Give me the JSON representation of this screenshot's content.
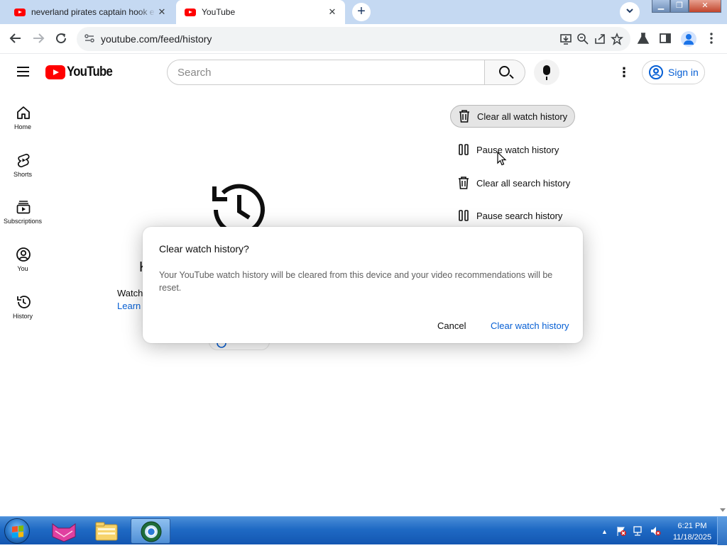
{
  "browser": {
    "tabs": [
      {
        "title": "neverland pirates captain hook e",
        "close": "✕"
      },
      {
        "title": "YouTube",
        "close": "✕"
      }
    ],
    "new_tab": "+",
    "url": "youtube.com/feed/history"
  },
  "masthead": {
    "logo_text": "YouTube",
    "search_placeholder": "Search",
    "kebab": "⋮",
    "sign_in_label": "Sign in"
  },
  "guide": {
    "items": [
      {
        "label": "Home",
        "icon": "home-icon"
      },
      {
        "label": "Shorts",
        "icon": "shorts-icon"
      },
      {
        "label": "Subscriptions",
        "icon": "subscriptions-icon"
      },
      {
        "label": "You",
        "icon": "you-icon"
      },
      {
        "label": "History",
        "icon": "history-icon"
      }
    ]
  },
  "main": {
    "watch_text_clip": "Watch",
    "learn_text_clip": "Learn r",
    "heading_clip": "K"
  },
  "actions": [
    {
      "label": "Clear all watch history",
      "icon": "trash-icon",
      "active": true
    },
    {
      "label": "Pause watch history",
      "icon": "pause-icon"
    },
    {
      "label": "Clear all search history",
      "icon": "trash-icon"
    },
    {
      "label": "Pause search history",
      "icon": "pause-icon"
    }
  ],
  "dialog": {
    "title": "Clear watch history?",
    "body": "Your YouTube watch history will be cleared from this device and your video recommendations will be reset.",
    "cancel": "Cancel",
    "confirm": "Clear watch history"
  },
  "taskbar": {
    "time": "6:21 PM",
    "date": "11/18/2025"
  },
  "colors": {
    "brand_red": "#ff0000",
    "link_blue": "#065fd4",
    "tabstrip": "#c5d9f2",
    "taskbar": "#1f6ac4"
  }
}
